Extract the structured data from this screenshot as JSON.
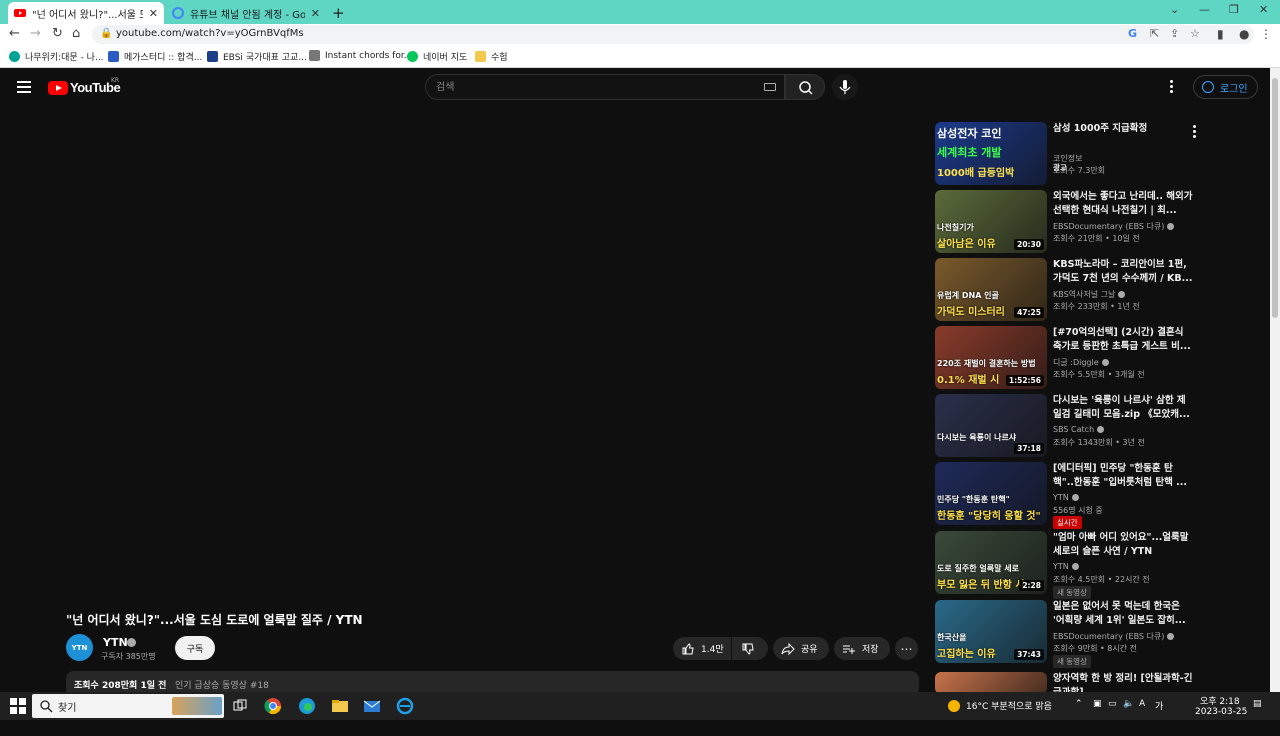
{
  "browser": {
    "tabs": [
      {
        "title": "\"넌 어디서 왔니?\"...서울 도심 도",
        "active": true
      },
      {
        "title": "유튜브 채널 안됨 계정 - Google",
        "active": false
      }
    ],
    "url": "youtube.com/watch?v=yOGrnBVqfMs",
    "bookmarks": [
      "나무위키:대문 - 나...",
      "메가스터디 :: 합격...",
      "EBSi 국가대표 고교...",
      "Instant chords for...",
      "네이버 지도",
      "수험"
    ]
  },
  "header": {
    "logo_text": "YouTube",
    "region": "KR",
    "search_placeholder": "검색",
    "login_label": "로그인"
  },
  "video": {
    "title": "\"넌 어디서 왔니?\"...서울 도심 도로에 얼룩말 질주 / YTN",
    "channel": "YTN",
    "avatar_text": "YTN",
    "subscribers": "구독자 385만명",
    "subscribe_label": "구독",
    "likes": "1.4만",
    "share_label": "공유",
    "save_label": "저장",
    "views_date": "조회수 208만회  1일 전",
    "trending": "인기 급상승 동영상 #18"
  },
  "recommendations": [
    {
      "title": "삼성 1000주 지급확정",
      "channel": "코인정보",
      "meta": "조회수 7.3만회",
      "badge": "광고",
      "badge_type": "ad",
      "duration": "",
      "cap1": "삼성전자 코인",
      "cap2": "세계최초 개발",
      "cap3": "1000배 급등임박",
      "thumb": "#1b3a8c"
    },
    {
      "title": "외국에서는 좋다고 난리데.. 해외가 선택한 현대식 나전칠기 | 최...",
      "channel": "EBSDocumentary (EBS 다큐)",
      "meta": "조회수 21만회 • 10일 전",
      "duration": "20:30",
      "cap1": "나전칠기가",
      "cap2": "살아남은 이유",
      "thumb": "#5b6b3a"
    },
    {
      "title": "KBS파노라마 – 코리안이브 1편, 가덕도 7천 년의 수수께끼 / KB...",
      "channel": "KBS역사저널 그날",
      "meta": "조회수 233만회 • 1년 전",
      "duration": "47:25",
      "cap1": "유럽계 DNA 인골",
      "cap2": "가덕도 미스터리",
      "thumb": "#7a5a2b"
    },
    {
      "title": "[#70억의선택] (2시간) 결혼식 축가로 등판한 초특급 게스트 비...",
      "channel": "디글 :Diggle",
      "meta": "조회수 5.5만회 • 3개월 전",
      "duration": "1:52:56",
      "cap1": "220조 재벌이 결혼하는 방법",
      "cap2": "0.1% 재벌 시",
      "thumb": "#8a3b2a"
    },
    {
      "title": "다시보는 '육룡이 나르샤' 삼한 제일검 길태미 모음.zip 《모았캐...",
      "channel": "SBS Catch",
      "meta": "조회수 1343만회 • 3년 전",
      "duration": "37:18",
      "cap1": "다시보는 육룡이 나르샤",
      "cap2": "",
      "thumb": "#2a2f4a"
    },
    {
      "title": "[에디터픽] 민주당 \"한동훈 탄핵\"..한동훈 \"입버릇처럼 탄핵 ...",
      "channel": "YTN",
      "meta": "556명 시청 중",
      "badge": "실시간",
      "badge_type": "live",
      "duration": "",
      "cap1": "민주당 \"한동훈 탄핵\"",
      "cap2": "한동훈 \"당당히 응할 것\"",
      "thumb": "#1e2a5a"
    },
    {
      "title": "\"엄마 아빠 어디 있어요\"...얼룩말 세로의 슬픈 사연 / YTN",
      "channel": "YTN",
      "meta": "조회수 4.5만회 • 22시간 전",
      "badge": "새 동영상",
      "badge_type": "new",
      "duration": "2:28",
      "cap1": "도로 질주한 얼룩말 세로",
      "cap2": "부모 잃은 뒤 반항 시",
      "thumb": "#3a4a3a"
    },
    {
      "title": "일본은 없어서 못 먹는데 한국은 '어획량 세계 1위' 일본도 잡히...",
      "channel": "EBSDocumentary (EBS 다큐)",
      "meta": "조회수 9만회 • 8시간 전",
      "badge": "새 동영상",
      "badge_type": "new",
      "duration": "37:43",
      "cap1": "한국산을",
      "cap2": "고집하는 이유",
      "thumb": "#2a6a8a"
    },
    {
      "title": "양자역학 한 방 정리! [안될과학-긴급과학]",
      "channel": "",
      "meta": "",
      "duration": "",
      "cap1": "",
      "cap2": "",
      "thumb": "#c8734a"
    }
  ],
  "taskbar": {
    "search_text": "찾기",
    "weather": "16°C  부분적으로 맑음",
    "time": "오후 2:18",
    "date": "2023-03-25"
  },
  "colors": {
    "page_bg": "#0f0f0f",
    "tab_strip": "#5fd6c4",
    "youtube_red": "#ff0000",
    "link_blue": "#3ea6ff",
    "live_red": "#cc0000"
  }
}
